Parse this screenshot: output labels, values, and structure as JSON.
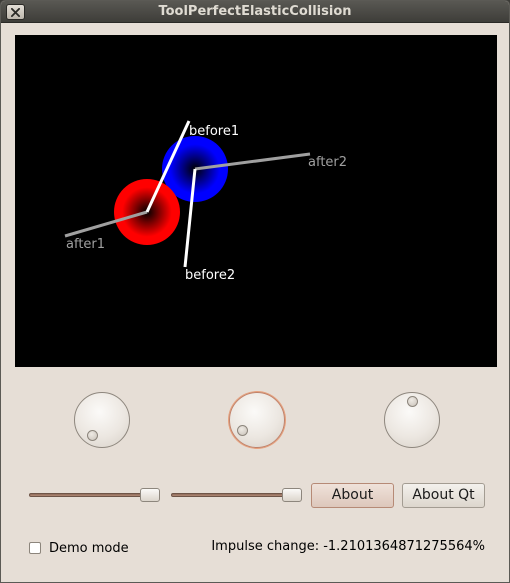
{
  "window": {
    "title": "ToolPerfectElasticCollision"
  },
  "canvas": {
    "labels": {
      "before1": "before1",
      "before2": "before2",
      "after1": "after1",
      "after2": "after2"
    }
  },
  "dials": [
    {
      "name": "dial-1",
      "focused": false
    },
    {
      "name": "dial-2",
      "focused": true
    },
    {
      "name": "dial-3",
      "focused": false
    }
  ],
  "sliders": [
    {
      "name": "slider-1",
      "value_fraction": 0.97
    },
    {
      "name": "slider-2",
      "value_fraction": 0.97
    }
  ],
  "buttons": {
    "about": "About",
    "about_qt": "About Qt"
  },
  "demo_mode": {
    "label": "Demo mode",
    "checked": false
  },
  "status": {
    "impulse_change": "Impulse change: -1.2101364871275564%"
  },
  "colors": {
    "ball1": "#ff0000",
    "ball2": "#0000ff",
    "canvas_bg": "#000000"
  },
  "icons": {
    "close": "close-icon"
  }
}
